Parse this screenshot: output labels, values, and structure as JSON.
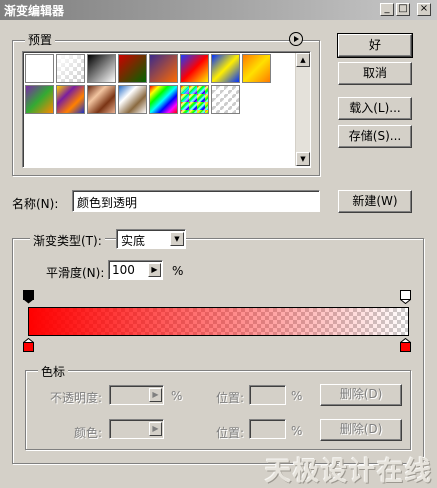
{
  "window": {
    "title": "渐变编辑器",
    "controls": {
      "minimize": "_",
      "maximize": "□",
      "close": "×"
    }
  },
  "presets": {
    "label": "预置",
    "menu_icon": "circle-arrow-right-icon",
    "swatches": [
      {
        "name": "foreground-to-background",
        "colors": [
          "#ffffff",
          "#ffffff"
        ]
      },
      {
        "name": "foreground-to-transparent",
        "colors": [
          "#ffffff",
          "transparent"
        ]
      },
      {
        "name": "black-white",
        "colors": [
          "#000000",
          "#ffffff"
        ]
      },
      {
        "name": "red-green",
        "colors": [
          "#cc0000",
          "#006600"
        ]
      },
      {
        "name": "violet-orange",
        "colors": [
          "#3a2a8c",
          "#ff6a00"
        ]
      },
      {
        "name": "blue-red-yellow",
        "colors": [
          "#1a3cff",
          "#ff0000",
          "#ffee00"
        ]
      },
      {
        "name": "blue-yellow-blue",
        "colors": [
          "#0030ff",
          "#ffee00",
          "#0030ff"
        ]
      },
      {
        "name": "orange-yellow-orange",
        "colors": [
          "#ff7a00",
          "#ffe000",
          "#ff7a00"
        ]
      },
      {
        "name": "violet-green-orange",
        "colors": [
          "#7a2aa8",
          "#33aa33",
          "#ff8800"
        ]
      },
      {
        "name": "yellow-violet-orange-blue",
        "colors": [
          "#ffd200",
          "#7a1f9e",
          "#ff8000",
          "#1a30c8"
        ]
      },
      {
        "name": "copper",
        "colors": [
          "#6b2a14",
          "#f2c4a0",
          "#7a3414",
          "#e8b090"
        ]
      },
      {
        "name": "chrome",
        "colors": [
          "#2a6fc8",
          "#ffffff",
          "#8a6a40",
          "#ffffff"
        ]
      },
      {
        "name": "spectrum",
        "colors": [
          "#ff0000",
          "#ffff00",
          "#00ff00",
          "#00ffff",
          "#0000ff",
          "#ff00ff",
          "#ff0000"
        ]
      },
      {
        "name": "transparent-rainbow",
        "colors": [
          "#ff0000",
          "#ffff00",
          "#00ff00",
          "#00ffff",
          "#0000ff",
          "#ff00ff"
        ]
      },
      {
        "name": "transparent-stripes",
        "colors": [
          "transparent",
          "#ffffff"
        ]
      }
    ]
  },
  "buttons": {
    "ok": "好",
    "cancel": "取消",
    "load": "载入(L)...",
    "save": "存储(S)...",
    "new": "新建(W)"
  },
  "name": {
    "label": "名称(N):",
    "value": "颜色到透明"
  },
  "gradient_type": {
    "label": "渐变类型(T):",
    "value": "实底"
  },
  "smoothness": {
    "label": "平滑度(N):",
    "value": "100",
    "unit": "%"
  },
  "gradient": {
    "color": "#ff0000",
    "opacity_start": 100,
    "opacity_end": 0
  },
  "stops": {
    "label": "色标",
    "opacity_label": "不透明度:",
    "opacity_unit": "%",
    "color_label": "颜色:",
    "location_label": "位置:",
    "location_unit": "%",
    "delete_label": "删除(D)"
  },
  "watermark": "天极设计在线"
}
